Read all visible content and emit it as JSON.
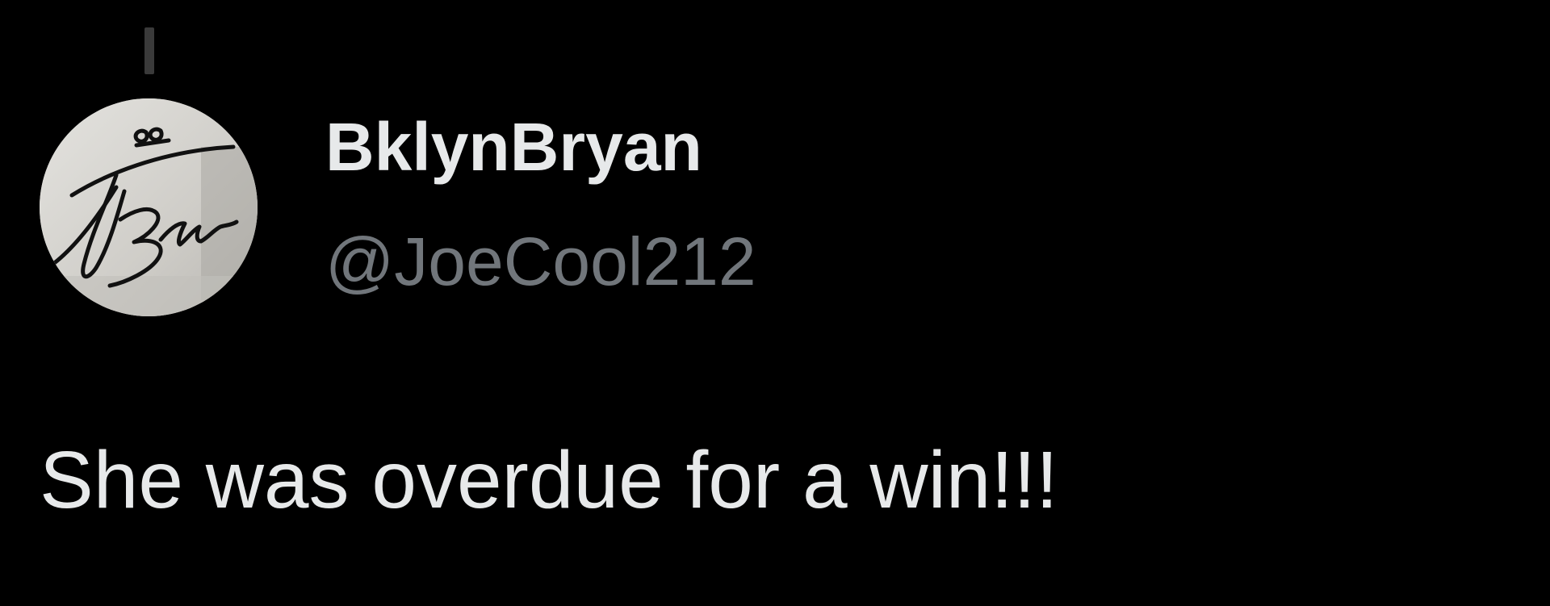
{
  "tweet": {
    "author": {
      "display_name": "BklynBryan",
      "handle": "@JoeCool212",
      "avatar_icon": "autograph-signature-avatar"
    },
    "text": "She was overdue for a win!!!"
  },
  "colors": {
    "background": "#000000",
    "primary_text": "#e7e9ea",
    "secondary_text": "#71767b",
    "thread_line": "#3a3a3a"
  }
}
